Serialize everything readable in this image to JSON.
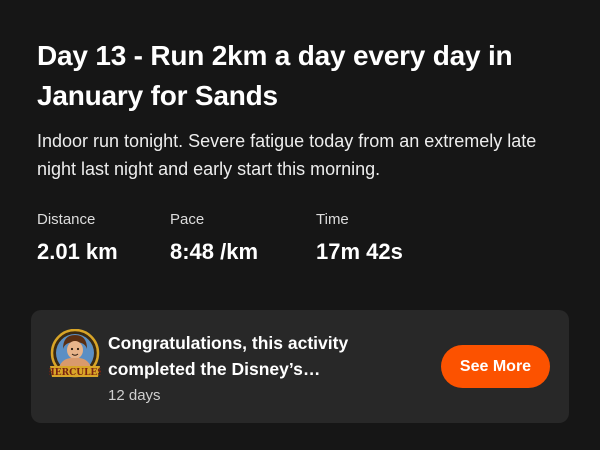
{
  "activity": {
    "title": "Day 13 - Run 2km a day every day in January for Sands",
    "description": "Indoor run tonight. Severe fatigue today from an extremely late night last night and early start this morning."
  },
  "stats": [
    {
      "label": "Distance",
      "value": "2.01 km"
    },
    {
      "label": "Pace",
      "value": "8:48 /km"
    },
    {
      "label": "Time",
      "value": "17m 42s"
    }
  ],
  "challenge_card": {
    "badge_icon": "hercules-challenge-badge",
    "badge_text": "HERCULES",
    "message": "Congratulations, this activity completed the Disney’s Hercules: Hero Challenge",
    "time_ago": "12 days",
    "button_label": "See More"
  },
  "colors": {
    "background": "#161616",
    "card_background": "#282828",
    "accent": "#fc5200",
    "badge_gold": "#d8a528"
  }
}
